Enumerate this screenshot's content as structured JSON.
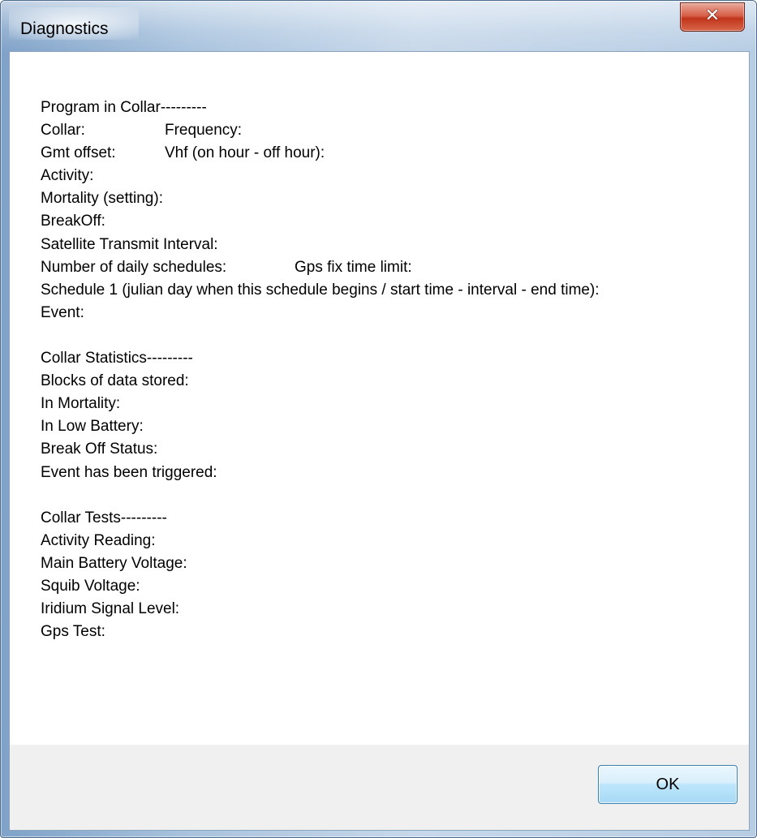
{
  "window": {
    "title": "Diagnostics",
    "close_glyph": "✕",
    "accent_close": "#c7402a",
    "frame_color": "#a9c3de"
  },
  "program": {
    "heading": "Program in Collar---------",
    "collar_label": "Collar:",
    "frequency_label": "Frequency:",
    "gmt_offset_label": "Gmt offset:",
    "vhf_label": "Vhf (on hour - off hour):",
    "activity_label": "Activity:",
    "mortality_label": "Mortality (setting):",
    "breakoff_label": "BreakOff:",
    "sat_interval_label": "Satellite Transmit Interval:",
    "daily_schedules_label": "Number of daily schedules:",
    "gps_fix_limit_label": "Gps fix time limit:",
    "schedule1_label": "Schedule 1 (julian day when this schedule begins / start time - interval - end time):",
    "event_label": "Event:"
  },
  "statistics": {
    "heading": "Collar Statistics---------",
    "blocks_label": "Blocks of data stored:",
    "in_mortality_label": "In Mortality:",
    "in_low_battery_label": "In Low Battery:",
    "break_off_status_label": "Break Off Status:",
    "event_triggered_label": "Event has been triggered:"
  },
  "tests": {
    "heading": "Collar Tests---------",
    "activity_reading_label": "Activity Reading:",
    "main_battery_label": "Main Battery Voltage:",
    "squib_voltage_label": "Squib Voltage:",
    "iridium_signal_label": "Iridium Signal Level:",
    "gps_test_label": "Gps Test:"
  },
  "footer": {
    "ok_label": "OK"
  }
}
